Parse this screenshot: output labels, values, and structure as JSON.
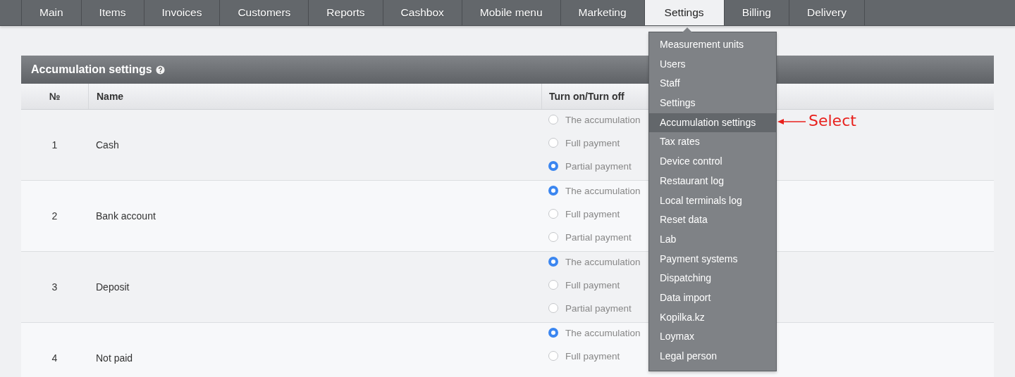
{
  "nav": {
    "tabs": [
      {
        "label": "Main",
        "selected": false
      },
      {
        "label": "Items",
        "selected": false
      },
      {
        "label": "Invoices",
        "selected": false
      },
      {
        "label": "Customers",
        "selected": false
      },
      {
        "label": "Reports",
        "selected": false
      },
      {
        "label": "Cashbox",
        "selected": false
      },
      {
        "label": "Mobile menu",
        "selected": false
      },
      {
        "label": "Marketing",
        "selected": false
      },
      {
        "label": "Settings",
        "selected": true
      },
      {
        "label": "Billing",
        "selected": false
      },
      {
        "label": "Delivery",
        "selected": false
      }
    ]
  },
  "dropdown": {
    "items": [
      {
        "label": "Measurement units",
        "selected": false
      },
      {
        "label": "Users",
        "selected": false
      },
      {
        "label": "Staff",
        "selected": false
      },
      {
        "label": "Settings",
        "selected": false
      },
      {
        "label": "Accumulation settings",
        "selected": true
      },
      {
        "label": "Tax rates",
        "selected": false
      },
      {
        "label": "Device control",
        "selected": false
      },
      {
        "label": "Restaurant log",
        "selected": false
      },
      {
        "label": "Local terminals log",
        "selected": false
      },
      {
        "label": "Reset data",
        "selected": false
      },
      {
        "label": "Lab",
        "selected": false
      },
      {
        "label": "Payment systems",
        "selected": false
      },
      {
        "label": "Dispatching",
        "selected": false
      },
      {
        "label": "Data import",
        "selected": false
      },
      {
        "label": "Kopilka.kz",
        "selected": false
      },
      {
        "label": "Loymax",
        "selected": false
      },
      {
        "label": "Legal person",
        "selected": false
      }
    ]
  },
  "annotation": {
    "text": "Select"
  },
  "panel": {
    "title": "Accumulation settings",
    "table": {
      "columns": [
        "№",
        "Name",
        "Turn on/Turn off"
      ],
      "rows": [
        {
          "number": "1",
          "name": "Cash",
          "options": [
            {
              "label": "The accumulation",
              "selected": false
            },
            {
              "label": "Full payment",
              "selected": false
            },
            {
              "label": "Partial payment",
              "selected": true
            }
          ]
        },
        {
          "number": "2",
          "name": "Bank account",
          "options": [
            {
              "label": "The accumulation",
              "selected": true
            },
            {
              "label": "Full payment",
              "selected": false
            },
            {
              "label": "Partial payment",
              "selected": false
            }
          ]
        },
        {
          "number": "3",
          "name": "Deposit",
          "options": [
            {
              "label": "The accumulation",
              "selected": true
            },
            {
              "label": "Full payment",
              "selected": false
            },
            {
              "label": "Partial payment",
              "selected": false
            }
          ]
        },
        {
          "number": "4",
          "name": "Not paid",
          "options": [
            {
              "label": "The accumulation",
              "selected": true
            },
            {
              "label": "Full payment",
              "selected": false
            }
          ]
        }
      ]
    }
  }
}
